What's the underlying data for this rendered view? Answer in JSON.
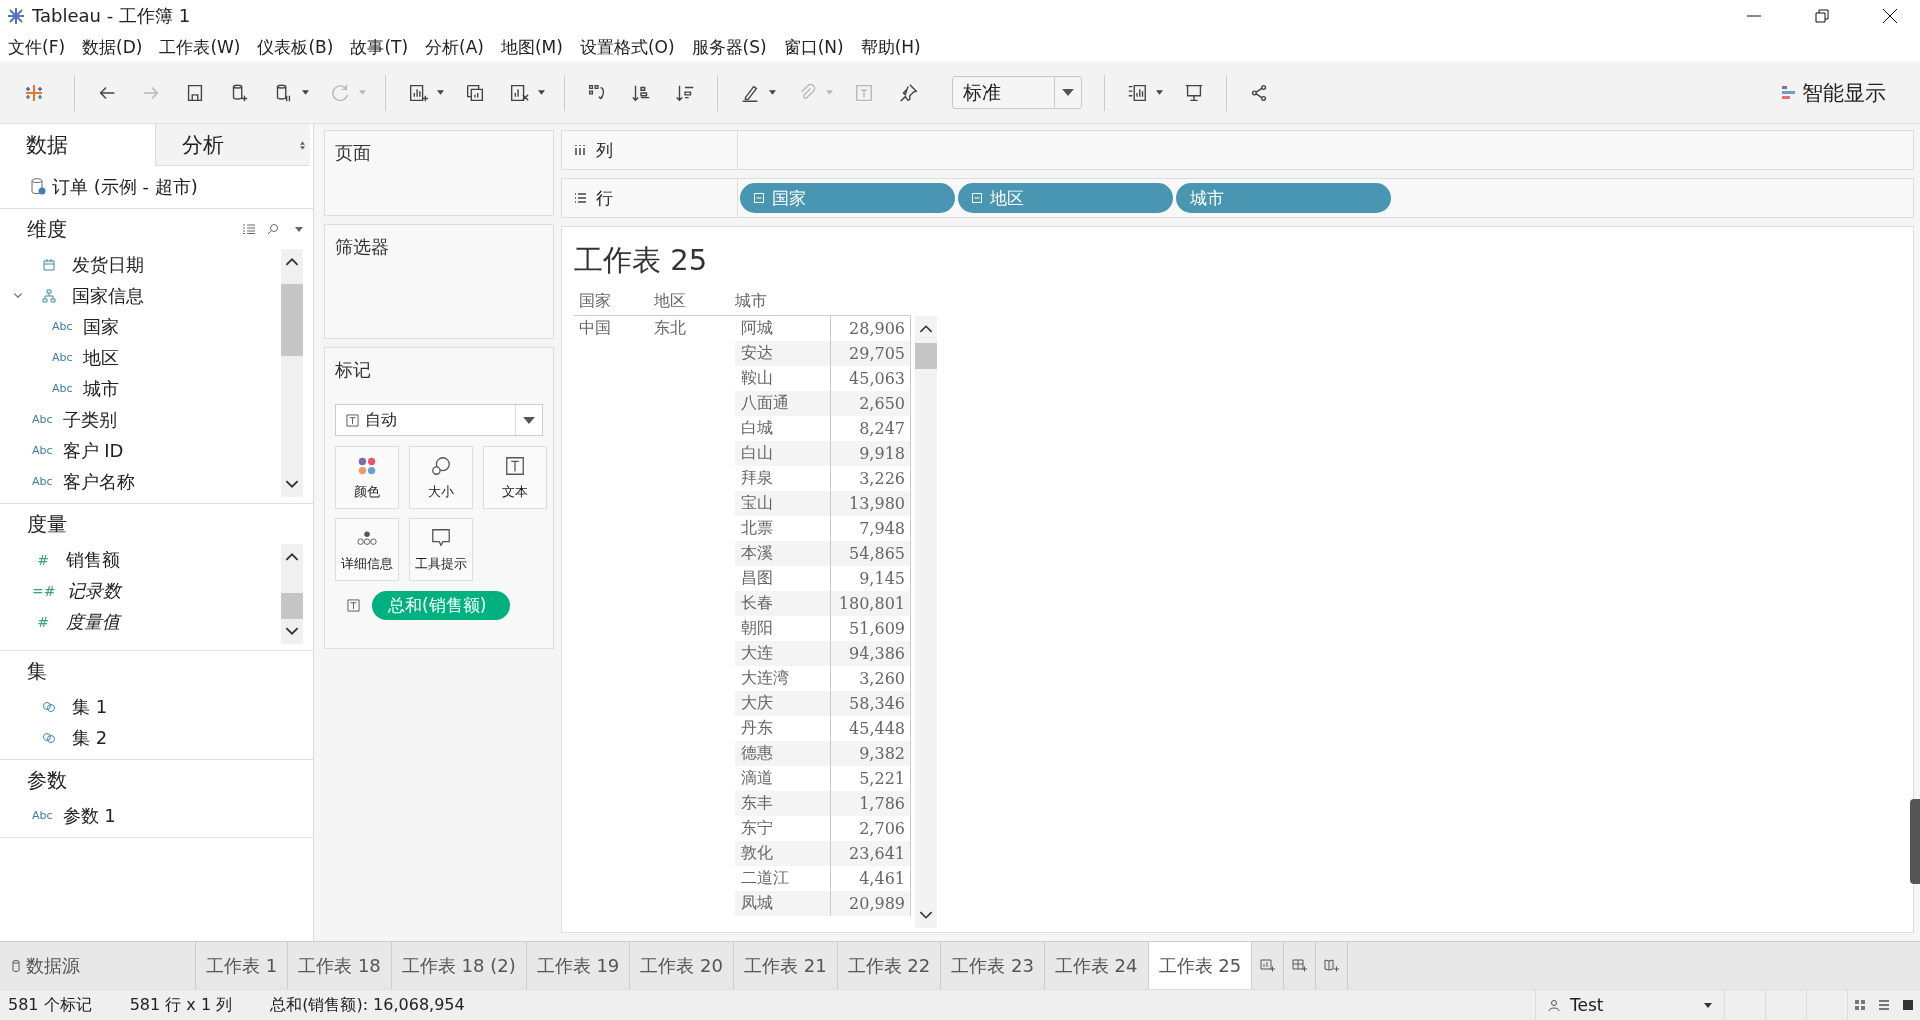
{
  "window": {
    "title": "Tableau - 工作簿 1"
  },
  "menu": [
    "文件(F)",
    "数据(D)",
    "工作表(W)",
    "仪表板(B)",
    "故事(T)",
    "分析(A)",
    "地图(M)",
    "设置格式(O)",
    "服务器(S)",
    "窗口(N)",
    "帮助(H)"
  ],
  "toolbar": {
    "tools": [
      {
        "kind": "back",
        "disabled": false,
        "caret": false
      },
      {
        "kind": "forward",
        "disabled": true,
        "caret": false
      },
      {
        "kind": "save",
        "disabled": false,
        "caret": false
      },
      {
        "kind": "new_datasource",
        "disabled": false,
        "caret": false
      },
      {
        "kind": "pause",
        "disabled": false,
        "caret": true
      },
      {
        "kind": "refresh",
        "disabled": true,
        "caret": true
      },
      {
        "kind": "new_sheet",
        "disabled": false,
        "caret": true
      },
      {
        "kind": "duplicate",
        "disabled": false,
        "caret": false
      },
      {
        "kind": "clear",
        "disabled": false,
        "caret": true
      },
      {
        "kind": "swap",
        "disabled": false,
        "caret": false
      },
      {
        "kind": "sort_asc",
        "disabled": false,
        "caret": false
      },
      {
        "kind": "sort_desc",
        "disabled": false,
        "caret": false
      },
      {
        "kind": "highlight",
        "disabled": false,
        "caret": true
      },
      {
        "kind": "attach",
        "disabled": true,
        "caret": true
      },
      {
        "kind": "label",
        "disabled": true,
        "caret": false
      },
      {
        "kind": "pin",
        "disabled": false,
        "caret": false
      }
    ],
    "fit": "标准",
    "tools_after": [
      {
        "kind": "chart",
        "disabled": false,
        "caret": true
      },
      {
        "kind": "presentation",
        "disabled": false,
        "caret": false
      },
      {
        "kind": "share",
        "disabled": false,
        "caret": false
      }
    ],
    "show_me": "智能显示"
  },
  "sidebar": {
    "tabs": [
      {
        "label": "数据",
        "selected": true
      },
      {
        "label": "分析",
        "selected": false
      }
    ],
    "datasource": "订单 (示例 - 超市)",
    "dimensions": {
      "title": "维度",
      "items": [
        {
          "label": "发货日期",
          "kind": "date"
        },
        {
          "label": "国家信息",
          "kind": "hierarchy",
          "expanded": true,
          "children": [
            {
              "label": "国家",
              "kind": "string",
              "icon_text": "Abc"
            },
            {
              "label": "地区",
              "kind": "string",
              "icon_text": "Abc"
            },
            {
              "label": "城市",
              "kind": "string",
              "icon_text": "Abc"
            }
          ]
        },
        {
          "label": "子类别",
          "kind": "string",
          "icon_text": "Abc"
        },
        {
          "label": "客户 ID",
          "kind": "string",
          "icon_text": "Abc"
        },
        {
          "label": "客户名称",
          "kind": "string",
          "icon_text": "Abc"
        }
      ]
    },
    "measures": {
      "title": "度量",
      "items": [
        {
          "label": "销售额",
          "kind": "number",
          "icon_text": "#",
          "italic": false
        },
        {
          "label": "记录数",
          "kind": "number",
          "icon_text": "=#",
          "italic": true
        },
        {
          "label": "度量值",
          "kind": "number",
          "icon_text": "#",
          "italic": true
        }
      ]
    },
    "sets": {
      "title": "集",
      "items": [
        {
          "label": "集 1",
          "kind": "set"
        },
        {
          "label": "集 2",
          "kind": "set"
        }
      ]
    },
    "parameters": {
      "title": "参数",
      "items": [
        {
          "label": "参数 1",
          "kind": "string",
          "icon_text": "Abc"
        }
      ]
    }
  },
  "pages": {
    "title": "页面"
  },
  "filters": {
    "title": "筛选器"
  },
  "marks": {
    "title": "标记",
    "type": "自动",
    "cards": [
      {
        "label": "颜色",
        "kind": "color"
      },
      {
        "label": "大小",
        "kind": "size"
      },
      {
        "label": "文本",
        "kind": "text"
      },
      {
        "label": "详细信息",
        "kind": "detail"
      },
      {
        "label": "工具提示",
        "kind": "tooltip"
      }
    ],
    "pill": "总和(销售额)"
  },
  "shelves": {
    "columns": {
      "label": "列"
    },
    "rows": {
      "label": "行",
      "pills": [
        {
          "label": "国家",
          "collapsible": true
        },
        {
          "label": "地区",
          "collapsible": true
        },
        {
          "label": "城市",
          "collapsible": false
        }
      ]
    }
  },
  "view": {
    "title": "工作表 25",
    "headers": [
      "国家",
      "地区",
      "城市"
    ],
    "country": "中国",
    "region": "东北",
    "rows": [
      {
        "city": "阿城",
        "value": "28,906"
      },
      {
        "city": "安达",
        "value": "29,705"
      },
      {
        "city": "鞍山",
        "value": "45,063"
      },
      {
        "city": "八面通",
        "value": "2,650"
      },
      {
        "city": "白城",
        "value": "8,247"
      },
      {
        "city": "白山",
        "value": "9,918"
      },
      {
        "city": "拜泉",
        "value": "3,226"
      },
      {
        "city": "宝山",
        "value": "13,980"
      },
      {
        "city": "北票",
        "value": "7,948"
      },
      {
        "city": "本溪",
        "value": "54,865"
      },
      {
        "city": "昌图",
        "value": "9,145"
      },
      {
        "city": "长春",
        "value": "180,801"
      },
      {
        "city": "朝阳",
        "value": "51,609"
      },
      {
        "city": "大连",
        "value": "94,386"
      },
      {
        "city": "大连湾",
        "value": "3,260"
      },
      {
        "city": "大庆",
        "value": "58,346"
      },
      {
        "city": "丹东",
        "value": "45,448"
      },
      {
        "city": "德惠",
        "value": "9,382"
      },
      {
        "city": "滴道",
        "value": "5,221"
      },
      {
        "city": "东丰",
        "value": "1,786"
      },
      {
        "city": "东宁",
        "value": "2,706"
      },
      {
        "city": "敦化",
        "value": "23,641"
      },
      {
        "city": "二道江",
        "value": "4,461"
      },
      {
        "city": "凤城",
        "value": "20,989"
      }
    ]
  },
  "sheet_tabs": {
    "datasource": "数据源",
    "tabs": [
      {
        "label": "工作表 1",
        "selected": false
      },
      {
        "label": "工作表 18",
        "selected": false
      },
      {
        "label": "工作表 18 (2)",
        "selected": false
      },
      {
        "label": "工作表 19",
        "selected": false
      },
      {
        "label": "工作表 20",
        "selected": false
      },
      {
        "label": "工作表 21",
        "selected": false
      },
      {
        "label": "工作表 22",
        "selected": false
      },
      {
        "label": "工作表 23",
        "selected": false
      },
      {
        "label": "工作表 24",
        "selected": false
      },
      {
        "label": "工作表 25",
        "selected": true
      }
    ]
  },
  "status_bar": {
    "marks": "581 个标记",
    "size": "581 行 x 1 列",
    "sum": "总和(销售额): 16,068,954",
    "user": "Test"
  }
}
